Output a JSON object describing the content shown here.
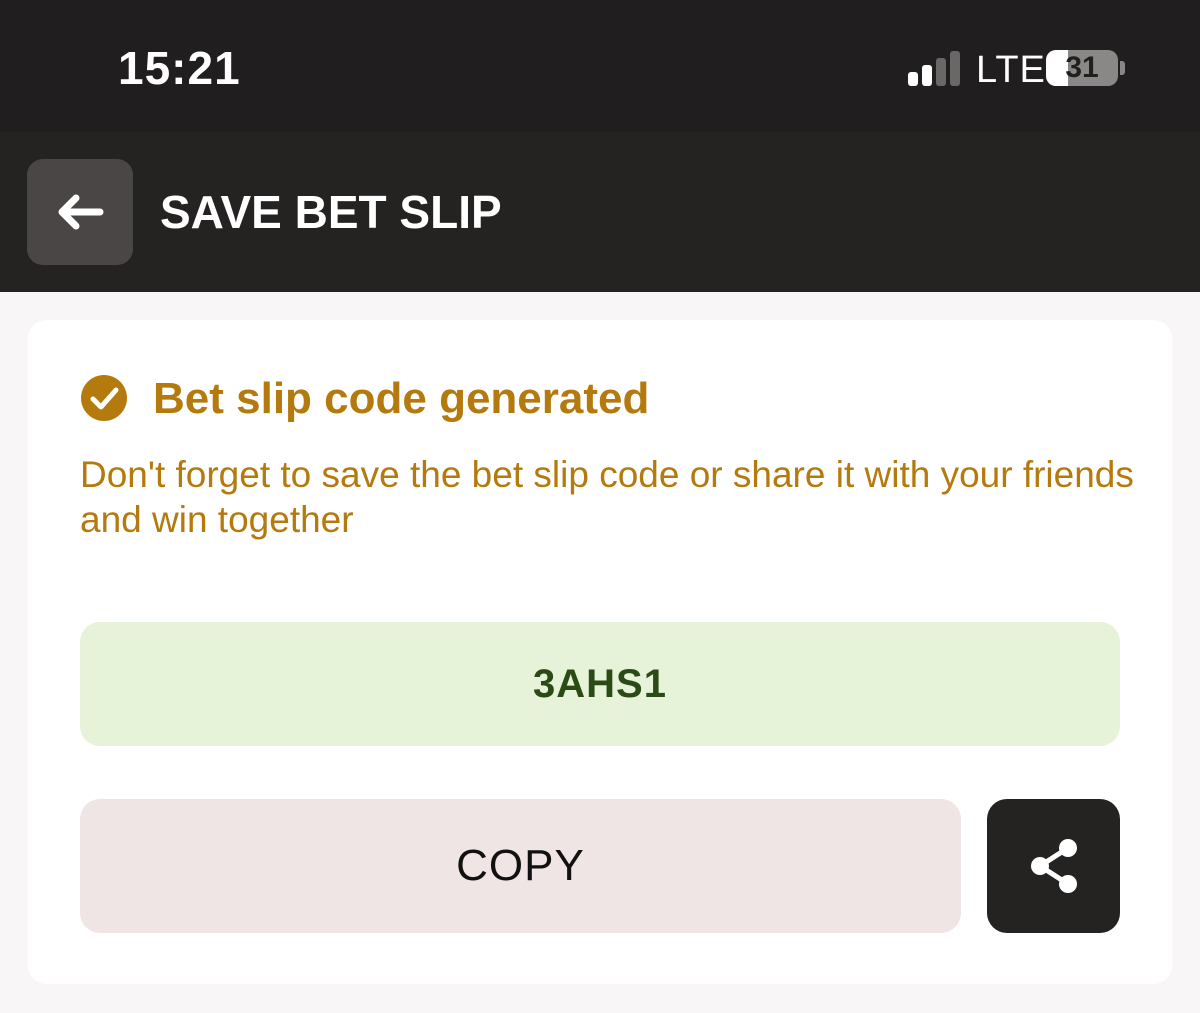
{
  "status_bar": {
    "time": "15:21",
    "network": "LTE",
    "battery": "31",
    "battery_level": 0.31,
    "signal_bars_active": 2,
    "signal_bars_total": 4
  },
  "header": {
    "back_icon": "arrow-left-icon",
    "title": "SAVE BET SLIP"
  },
  "card": {
    "success_icon": "check-circle-icon",
    "title": "Bet slip code generated",
    "description": "Don't forget to save the bet slip code or share it with your friends and win together",
    "code": "3AHS1",
    "copy_label": "COPY",
    "share_icon": "share-icon"
  },
  "colors": {
    "accent": "#b47a0e",
    "code_bg": "#e6f3d8",
    "code_text": "#2b4a16",
    "copy_bg": "#f0e5e5",
    "dark": "#252222"
  }
}
